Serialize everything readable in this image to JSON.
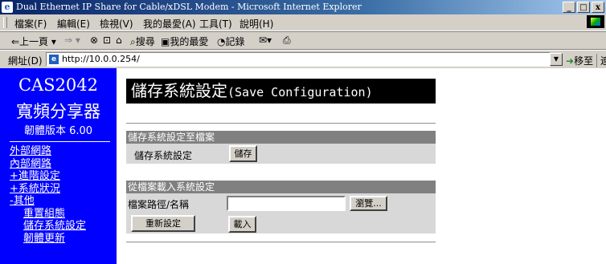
{
  "window": {
    "title": "Dual Ethernet IP Share for Cable/xDSL Modem - Microsoft Internet Explorer",
    "controls": {
      "minimize": "_",
      "maximize": "□",
      "close": "x"
    }
  },
  "menu": [
    "檔案(F)",
    "編輯(E)",
    "檢視(V)",
    "我的最愛(A)",
    "工具(T)",
    "說明(H)"
  ],
  "toolbar": {
    "back": "⇐上一頁 ▾",
    "forward": "⇒ ▾",
    "stop": "⊗",
    "refresh": "⊡",
    "home": "⌂",
    "search": "搜尋",
    "favorites": "我的最愛",
    "history": "記錄",
    "mail": "✉▾",
    "print": "⎙"
  },
  "address": {
    "label": "網址(D)",
    "url": "http://10.0.0.254/",
    "go_label": "移至",
    "links_label": "連結 »"
  },
  "sidebar": {
    "brand_line1": "CAS2042",
    "brand_line2": "寬頻分享器",
    "firmware": "韌體版本 6.00",
    "nav": [
      {
        "label": "外部網路"
      },
      {
        "label": "內部網路"
      },
      {
        "label": "+進階設定"
      },
      {
        "label": "+系統狀況"
      },
      {
        "label": "-其他"
      },
      {
        "label": "重置組態"
      },
      {
        "label": "儲存系統設定"
      },
      {
        "label": "韌體更新"
      }
    ]
  },
  "main": {
    "title_zh": "儲存系統設定",
    "title_en": "(Save Configuration)",
    "save_section": {
      "header": "儲存系統設定至檔案",
      "row_label": "儲存系統設定",
      "save_button": "儲存"
    },
    "load_section": {
      "header": "從檔案載入系統設定",
      "path_label": "檔案路徑/名稱",
      "path_value": "",
      "browse_button": "瀏覽...",
      "reset_button": "重新設定",
      "load_button": "載入"
    }
  },
  "colors": {
    "sidebar_bg": "#0000ff",
    "section_header_bg": "#808080",
    "section_row_bg": "#d8d8d8",
    "title_bg": "#000000"
  }
}
